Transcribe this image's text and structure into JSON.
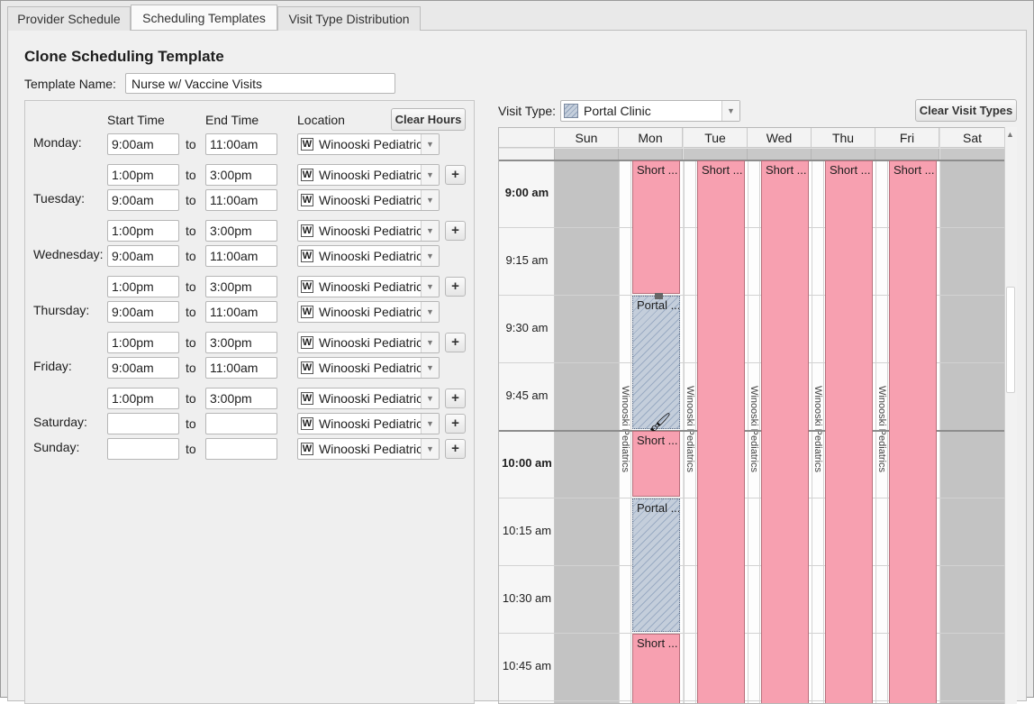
{
  "tabs": [
    {
      "label": "Provider Schedule",
      "active": false
    },
    {
      "label": "Scheduling Templates",
      "active": true
    },
    {
      "label": "Visit Type Distribution",
      "active": false
    }
  ],
  "form": {
    "title": "Clone Scheduling Template",
    "template_name_label": "Template Name:",
    "template_name_value": "Nurse w/ Vaccine Visits"
  },
  "hours": {
    "headers": {
      "start": "Start Time",
      "end": "End Time",
      "location": "Location"
    },
    "clear_hours_label": "Clear Hours",
    "to_label": "to",
    "add_label": "+",
    "days": [
      {
        "name": "Monday:",
        "rows": [
          {
            "start": "9:00am",
            "end": "11:00am",
            "location": "Winooski Pediatrics"
          },
          {
            "start": "1:00pm",
            "end": "3:00pm",
            "location": "Winooski Pediatrics"
          }
        ]
      },
      {
        "name": "Tuesday:",
        "rows": [
          {
            "start": "9:00am",
            "end": "11:00am",
            "location": "Winooski Pediatrics"
          },
          {
            "start": "1:00pm",
            "end": "3:00pm",
            "location": "Winooski Pediatrics"
          }
        ]
      },
      {
        "name": "Wednesday:",
        "rows": [
          {
            "start": "9:00am",
            "end": "11:00am",
            "location": "Winooski Pediatrics"
          },
          {
            "start": "1:00pm",
            "end": "3:00pm",
            "location": "Winooski Pediatrics"
          }
        ]
      },
      {
        "name": "Thursday:",
        "rows": [
          {
            "start": "9:00am",
            "end": "11:00am",
            "location": "Winooski Pediatrics"
          },
          {
            "start": "1:00pm",
            "end": "3:00pm",
            "location": "Winooski Pediatrics"
          }
        ]
      },
      {
        "name": "Friday:",
        "rows": [
          {
            "start": "9:00am",
            "end": "11:00am",
            "location": "Winooski Pediatrics"
          },
          {
            "start": "1:00pm",
            "end": "3:00pm",
            "location": "Winooski Pediatrics"
          }
        ]
      },
      {
        "name": "Saturday:",
        "rows": [
          {
            "start": "",
            "end": "",
            "location": "Winooski Pediatrics"
          }
        ]
      },
      {
        "name": "Sunday:",
        "rows": [
          {
            "start": "",
            "end": "",
            "location": "Winooski Pediatrics"
          }
        ]
      }
    ],
    "location_icon_letter": "W"
  },
  "visit_type": {
    "label": "Visit Type:",
    "selected": "Portal Clinic",
    "clear_label": "Clear Visit Types"
  },
  "calendar": {
    "days": [
      "Sun",
      "Mon",
      "Tue",
      "Wed",
      "Thu",
      "Fri",
      "Sat"
    ],
    "times": [
      {
        "label": "9:00 am",
        "bold": true
      },
      {
        "label": "9:15 am",
        "bold": false
      },
      {
        "label": "9:30 am",
        "bold": false
      },
      {
        "label": "9:45 am",
        "bold": false
      },
      {
        "label": "10:00 am",
        "bold": true
      },
      {
        "label": "10:15 am",
        "bold": false
      },
      {
        "label": "10:30 am",
        "bold": false
      },
      {
        "label": "10:45 am",
        "bold": false
      }
    ],
    "location_label": "Winooski Pediatrics",
    "short_label": "Short ...",
    "portal_label": "Portal ...",
    "colors": {
      "short": "#f7a0b0",
      "portal": "#aab8cc",
      "closed": "#c3c3c3"
    }
  }
}
